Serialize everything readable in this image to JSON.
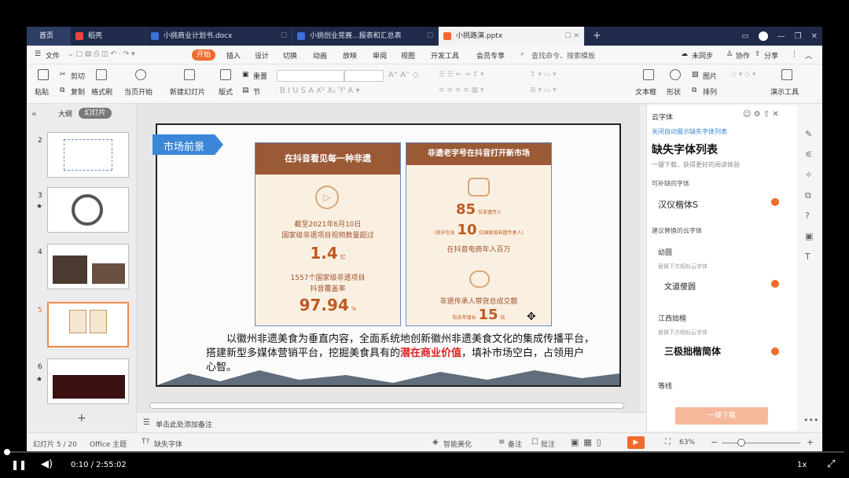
{
  "tabs": [
    {
      "label": "首页"
    },
    {
      "label": "稻壳"
    },
    {
      "label": "小挑商业计划书.docx"
    },
    {
      "label": "小挑创业竞赛...报表和汇总表"
    },
    {
      "label": "小挑路演.pptx"
    }
  ],
  "menu": {
    "file": "文件",
    "items": [
      "开始",
      "插入",
      "设计",
      "切换",
      "动画",
      "放映",
      "审阅",
      "视图",
      "开发工具",
      "会员专享"
    ],
    "search": "查找命令、搜索模板",
    "sync": "未同步",
    "collab": "协作",
    "share": "分享"
  },
  "ribbon": {
    "paste": "粘贴",
    "cut": "剪切",
    "copy": "复制",
    "format_painter": "格式刷",
    "from_current": "当页开始",
    "new_slide": "新建幻灯片",
    "layout": "版式",
    "section": "节",
    "reset": "重置",
    "text_box": "文本框",
    "shape": "形状",
    "picture": "图片",
    "arrange": "排列",
    "presentation_tools": "演示工具"
  },
  "left_panel": {
    "tab_outline": "大纲",
    "tab_slides": "幻灯片",
    "slide_numbers": [
      "2",
      "3",
      "4",
      "5",
      "6"
    ],
    "add": "+"
  },
  "slide": {
    "tag": "市场前景",
    "card1": {
      "header": "在抖音看见每一种非遗",
      "line1": "截至2021年6月10日",
      "line2": "国家级非遗项目视频数量超过",
      "big1": "1.4",
      "unit1": "亿",
      "line3": "1557个国家级非遗项目",
      "line4": "抖音覆盖率",
      "big2": "97.94",
      "unit2": "%"
    },
    "card2": {
      "header": "非遗老字号在抖音打开新市场",
      "big1": "85",
      "small1": "位非遗传人",
      "pre2": "(其中包含",
      "big2": "10",
      "small2": "位国家级非遗传承人)",
      "line3": "在抖音电商年入百万",
      "line4": "非遗传承人带货总成交额",
      "pre5": "较去年增长",
      "big3": "15",
      "unit3": "倍"
    },
    "body_pre": "以徽州非遗美食为垂直内容，全面系统地创新徽州非遗美食文化的集成传播平台，搭建新型多媒体营销平台，挖掘美食具有的",
    "body_highlight": "潜在商业价值",
    "body_post": "，填补市场空白，占领用户心智。"
  },
  "notes": "单击此处添加备注",
  "right_panel": {
    "header": "云字体",
    "link": "关闭自动展示缺失字体列表",
    "title": "缺失字体列表",
    "subtitle": "一键下载，获得更好的阅读体验",
    "section1": "可补缺的字体",
    "font1": "汉仪楷体S",
    "section2": "建议替换的云字体",
    "item1": "幼圆",
    "item1_hint": "替换下方相似云字体",
    "item1_font": "文道傻圆",
    "item2": "江西拙楷",
    "item2_hint": "替换下方相似云字体",
    "item2_font": "三极拙楷简体",
    "item3": "等线",
    "download": "一键下载"
  },
  "status": {
    "slide_info": "幻灯片 5 / 20",
    "theme": "Office 主题",
    "missing_font": "缺失字体",
    "smart": "智能美化",
    "notes": "备注",
    "comment": "批注",
    "zoom": "63%"
  },
  "player": {
    "time": "0:10 / 2:55:02",
    "speed": "1x",
    "progress": 0.001
  },
  "colors": {
    "accent": "#f06b2b",
    "card_header": "#9a5a36",
    "highlight": "#e02020",
    "tag": "#3b86d8"
  }
}
